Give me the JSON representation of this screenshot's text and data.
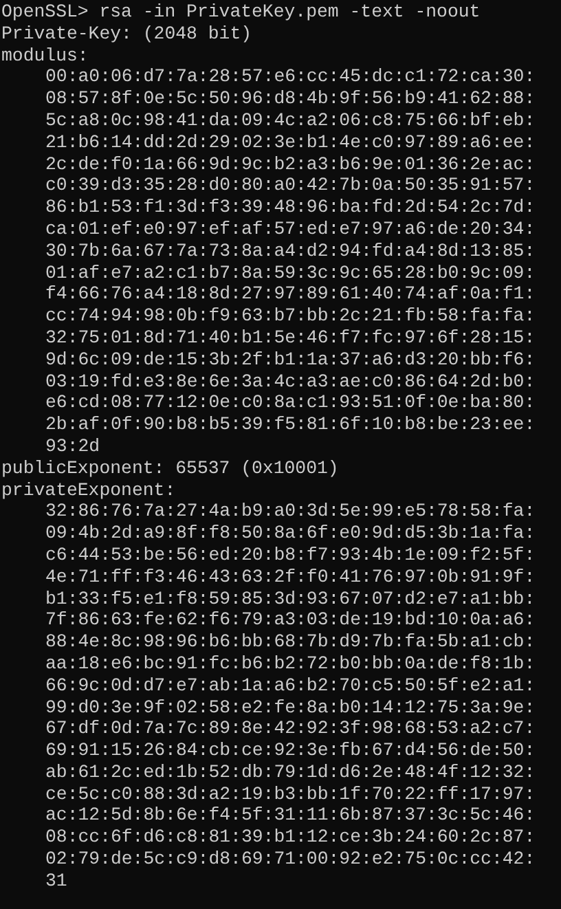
{
  "console": {
    "lines": [
      {
        "kind": "command",
        "text": "OpenSSL> rsa -in PrivateKey.pem -text -noout"
      },
      {
        "kind": "label",
        "text": "Private-Key: (2048 bit)"
      },
      {
        "kind": "label",
        "text": "modulus:"
      },
      {
        "kind": "hex",
        "text": "00:a0:06:d7:7a:28:57:e6:cc:45:dc:c1:72:ca:30:"
      },
      {
        "kind": "hex",
        "text": "08:57:8f:0e:5c:50:96:d8:4b:9f:56:b9:41:62:88:"
      },
      {
        "kind": "hex",
        "text": "5c:a8:0c:98:41:da:09:4c:a2:06:c8:75:66:bf:eb:"
      },
      {
        "kind": "hex",
        "text": "21:b6:14:dd:2d:29:02:3e:b1:4e:c0:97:89:a6:ee:"
      },
      {
        "kind": "hex",
        "text": "2c:de:f0:1a:66:9d:9c:b2:a3:b6:9e:01:36:2e:ac:"
      },
      {
        "kind": "hex",
        "text": "c0:39:d3:35:28:d0:80:a0:42:7b:0a:50:35:91:57:"
      },
      {
        "kind": "hex",
        "text": "86:b1:53:f1:3d:f3:39:48:96:ba:fd:2d:54:2c:7d:"
      },
      {
        "kind": "hex",
        "text": "ca:01:ef:e0:97:ef:af:57:ed:e7:97:a6:de:20:34:"
      },
      {
        "kind": "hex",
        "text": "30:7b:6a:67:7a:73:8a:a4:d2:94:fd:a4:8d:13:85:"
      },
      {
        "kind": "hex",
        "text": "01:af:e7:a2:c1:b7:8a:59:3c:9c:65:28:b0:9c:09:"
      },
      {
        "kind": "hex",
        "text": "f4:66:76:a4:18:8d:27:97:89:61:40:74:af:0a:f1:"
      },
      {
        "kind": "hex",
        "text": "cc:74:94:98:0b:f9:63:b7:bb:2c:21:fb:58:fa:fa:"
      },
      {
        "kind": "hex",
        "text": "32:75:01:8d:71:40:b1:5e:46:f7:fc:97:6f:28:15:"
      },
      {
        "kind": "hex",
        "text": "9d:6c:09:de:15:3b:2f:b1:1a:37:a6:d3:20:bb:f6:"
      },
      {
        "kind": "hex",
        "text": "03:19:fd:e3:8e:6e:3a:4c:a3:ae:c0:86:64:2d:b0:"
      },
      {
        "kind": "hex",
        "text": "e6:cd:08:77:12:0e:c0:8a:c1:93:51:0f:0e:ba:80:"
      },
      {
        "kind": "hex",
        "text": "2b:af:0f:90:b8:b5:39:f5:81:6f:10:b8:be:23:ee:"
      },
      {
        "kind": "hex",
        "text": "93:2d"
      },
      {
        "kind": "label",
        "text": "publicExponent: 65537 (0x10001)"
      },
      {
        "kind": "label",
        "text": "privateExponent:"
      },
      {
        "kind": "hex",
        "text": "32:86:76:7a:27:4a:b9:a0:3d:5e:99:e5:78:58:fa:"
      },
      {
        "kind": "hex",
        "text": "09:4b:2d:a9:8f:f8:50:8a:6f:e0:9d:d5:3b:1a:fa:"
      },
      {
        "kind": "hex",
        "text": "c6:44:53:be:56:ed:20:b8:f7:93:4b:1e:09:f2:5f:"
      },
      {
        "kind": "hex",
        "text": "4e:71:ff:f3:46:43:63:2f:f0:41:76:97:0b:91:9f:"
      },
      {
        "kind": "hex",
        "text": "b1:33:f5:e1:f8:59:85:3d:93:67:07:d2:e7:a1:bb:"
      },
      {
        "kind": "hex",
        "text": "7f:86:63:fe:62:f6:79:a3:03:de:19:bd:10:0a:a6:"
      },
      {
        "kind": "hex",
        "text": "88:4e:8c:98:96:b6:bb:68:7b:d9:7b:fa:5b:a1:cb:"
      },
      {
        "kind": "hex",
        "text": "aa:18:e6:bc:91:fc:b6:b2:72:b0:bb:0a:de:f8:1b:"
      },
      {
        "kind": "hex",
        "text": "66:9c:0d:d7:e7:ab:1a:a6:b2:70:c5:50:5f:e2:a1:"
      },
      {
        "kind": "hex",
        "text": "99:d0:3e:9f:02:58:e2:fe:8a:b0:14:12:75:3a:9e:"
      },
      {
        "kind": "hex",
        "text": "67:df:0d:7a:7c:89:8e:42:92:3f:98:68:53:a2:c7:"
      },
      {
        "kind": "hex",
        "text": "69:91:15:26:84:cb:ce:92:3e:fb:67:d4:56:de:50:"
      },
      {
        "kind": "hex",
        "text": "ab:61:2c:ed:1b:52:db:79:1d:d6:2e:48:4f:12:32:"
      },
      {
        "kind": "hex",
        "text": "ce:5c:c0:88:3d:a2:19:b3:bb:1f:70:22:ff:17:97:"
      },
      {
        "kind": "hex",
        "text": "ac:12:5d:8b:6e:f4:5f:31:11:6b:87:37:3c:5c:46:"
      },
      {
        "kind": "hex",
        "text": "08:cc:6f:d6:c8:81:39:b1:12:ce:3b:24:60:2c:87:"
      },
      {
        "kind": "hex",
        "text": "02:79:de:5c:c9:d8:69:71:00:92:e2:75:0c:cc:42:"
      },
      {
        "kind": "hex",
        "text": "31"
      }
    ]
  }
}
